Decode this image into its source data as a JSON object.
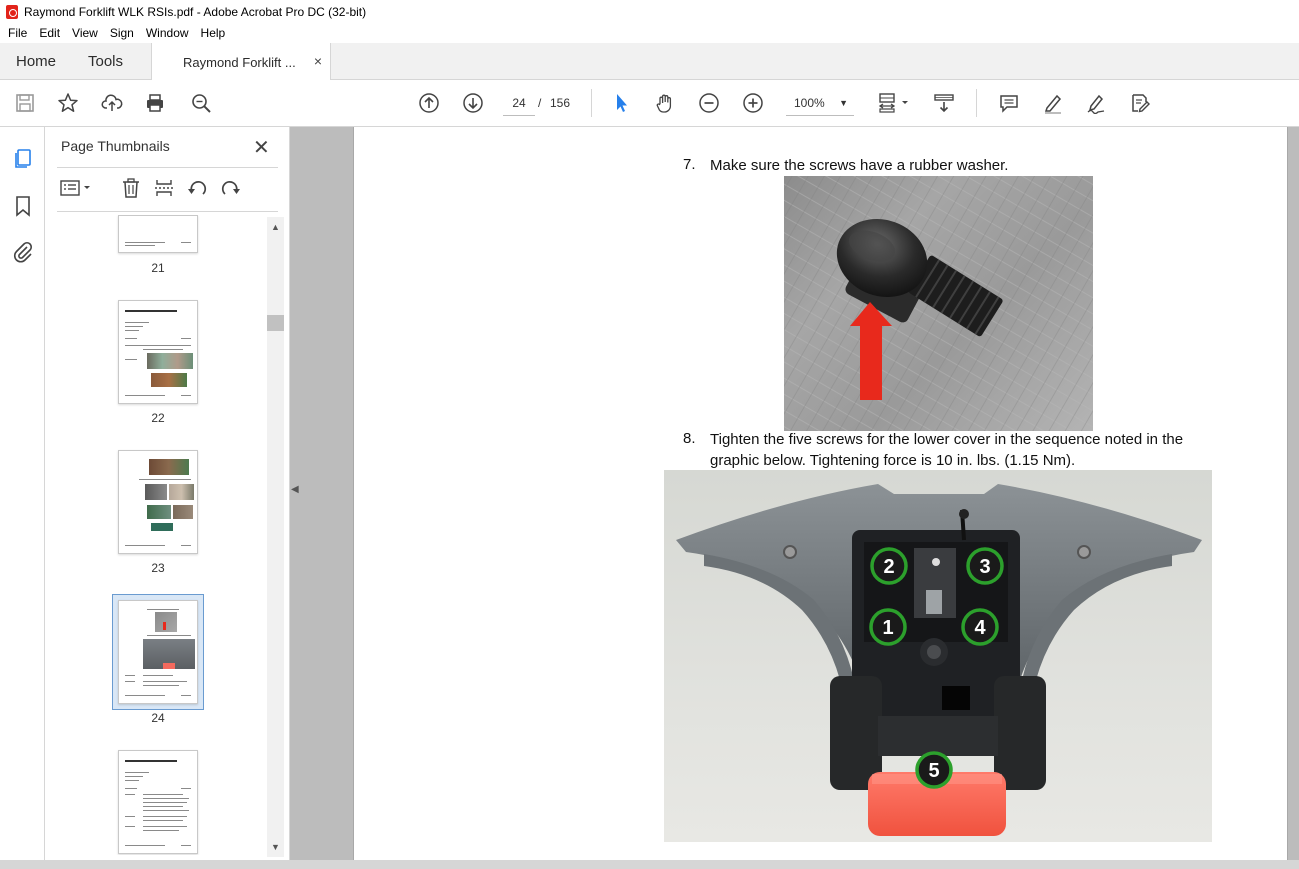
{
  "window": {
    "title": "Raymond Forklift WLK RSIs.pdf - Adobe Acrobat Pro DC (32-bit)"
  },
  "menu": [
    "File",
    "Edit",
    "View",
    "Sign",
    "Window",
    "Help"
  ],
  "tabs": {
    "home": "Home",
    "tools": "Tools",
    "document": "Raymond Forklift ...",
    "close": "×"
  },
  "toolbar": {
    "page_current": "24",
    "page_separator": "/",
    "page_total": "156",
    "zoom": "100%",
    "icons": [
      "save-icon",
      "star-icon",
      "upload-icon",
      "print-icon",
      "search-zoom-icon",
      "arrow-up-icon",
      "arrow-down-icon",
      "select-cursor-icon",
      "hand-icon",
      "zoom-out-icon",
      "zoom-in-icon",
      "fit-page-icon",
      "scroll-mode-icon",
      "comment-icon",
      "highlight-icon",
      "sign-icon",
      "edit-icon"
    ],
    "accent": "#2680eb"
  },
  "panel": {
    "title": "Page Thumbnails",
    "close": "✕",
    "thumbnails": [
      {
        "label": "21"
      },
      {
        "label": "22"
      },
      {
        "label": "23"
      },
      {
        "label": "24",
        "selected": true
      },
      {
        "label": ""
      }
    ]
  },
  "document": {
    "steps": [
      {
        "num": "7.",
        "text": "Make sure the screws have a rubber washer."
      },
      {
        "num": "8.",
        "text_line1": "Tighten the five screws for the lower cover in the sequence noted in the",
        "text_line2": "graphic below. Tightening force is 10 in. lbs. (1.15 Nm)."
      }
    ],
    "callouts": [
      "1",
      "2",
      "3",
      "4",
      "5"
    ],
    "callout_color": "#2ca02c",
    "arrow_color": "#e8291c"
  }
}
